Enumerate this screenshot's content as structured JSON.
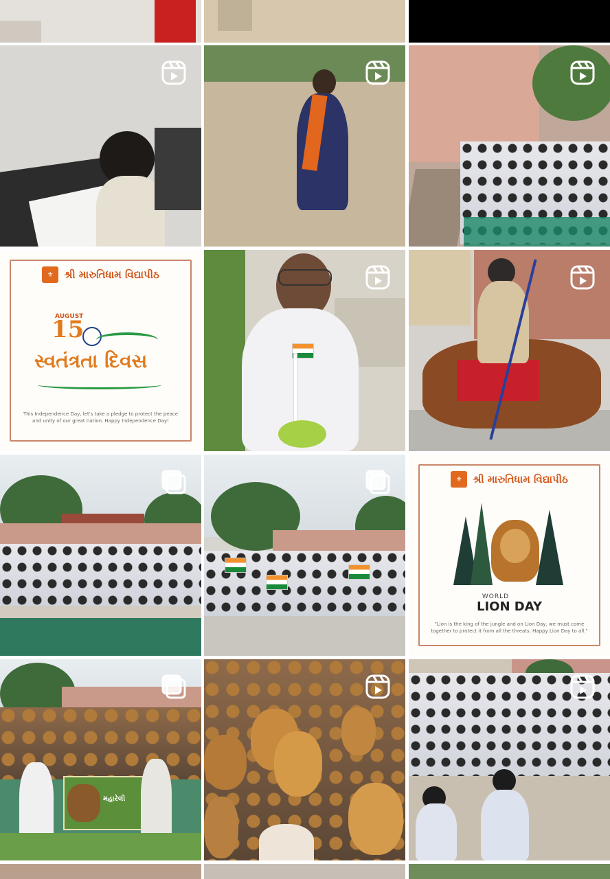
{
  "grid": {
    "tiles": [
      {
        "row": 0,
        "col": 0,
        "badge": "none"
      },
      {
        "row": 0,
        "col": 1,
        "badge": "none"
      },
      {
        "row": 0,
        "col": 2,
        "badge": "none"
      },
      {
        "row": 1,
        "col": 0,
        "badge": "reel-icon"
      },
      {
        "row": 1,
        "col": 1,
        "badge": "reel-icon"
      },
      {
        "row": 1,
        "col": 2,
        "badge": "reel-icon"
      },
      {
        "row": 2,
        "col": 0,
        "badge": "none"
      },
      {
        "row": 2,
        "col": 1,
        "badge": "reel-icon"
      },
      {
        "row": 2,
        "col": 2,
        "badge": "reel-icon"
      },
      {
        "row": 3,
        "col": 0,
        "badge": "carousel-icon"
      },
      {
        "row": 3,
        "col": 1,
        "badge": "carousel-icon"
      },
      {
        "row": 3,
        "col": 2,
        "badge": "none"
      },
      {
        "row": 4,
        "col": 0,
        "badge": "carousel-icon"
      },
      {
        "row": 4,
        "col": 1,
        "badge": "reel-icon"
      },
      {
        "row": 4,
        "col": 2,
        "badge": "reel-icon"
      }
    ]
  },
  "independence_post": {
    "school": "શ્રી મારુતિધામ વિદ્યાપીઠ",
    "month": "AUGUST",
    "day": "15",
    "title": "સ્વતંત્રતા દિવસ",
    "message": "This Independence Day, let's take a pledge to protect the peace and unity of our great nation. Happy Independence Day!"
  },
  "lion_post": {
    "school": "શ્રી મારુતિધામ વિદ્યાપીઠ",
    "title_small": "WORLD",
    "title_big": "LION DAY",
    "message": "\"Lion is the king of the jungle and on Lion Day, we must come together to protect it from all the threats. Happy Lion Day to all.\""
  },
  "banner_post": {
    "banner_text": "મહારેલી"
  },
  "colors": {
    "accent_orange": "#d1561a",
    "black_tile": "#000000",
    "badge_white": "#ffffff"
  }
}
